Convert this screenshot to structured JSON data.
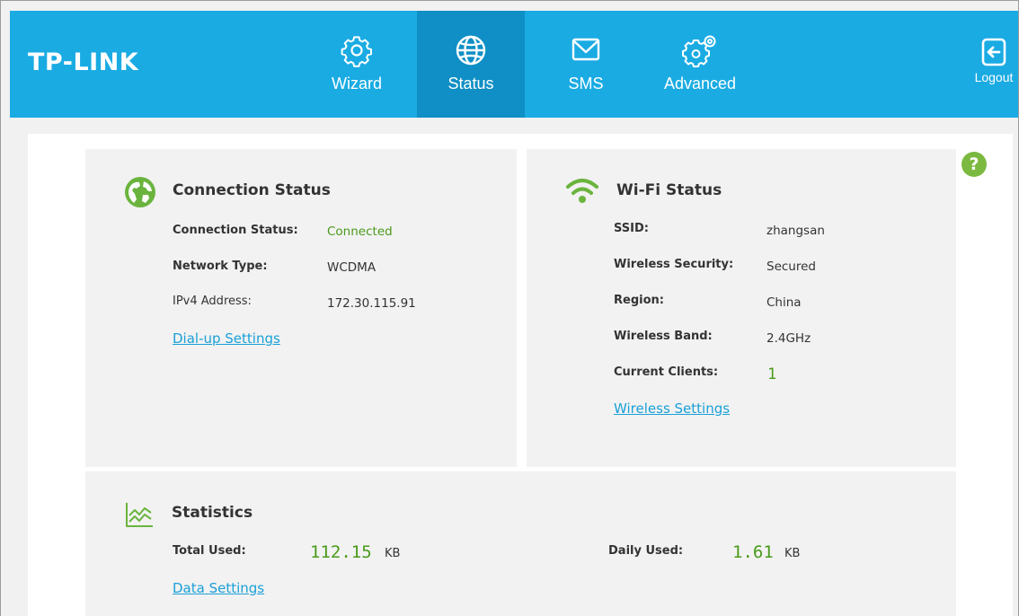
{
  "header": {
    "logo": "TP-LINK",
    "brand_color": "#1aabe3",
    "nav": [
      {
        "label": "Wizard",
        "icon": "gear-icon",
        "active": false
      },
      {
        "label": "Status",
        "icon": "globe-icon",
        "active": true
      },
      {
        "label": "SMS",
        "icon": "envelope-icon",
        "active": false
      },
      {
        "label": "Advanced",
        "icon": "gears-icon",
        "active": false
      }
    ],
    "logout_label": "Logout"
  },
  "connection": {
    "title": "Connection Status",
    "status_label": "Connection Status:",
    "status_value": "Connected",
    "network_type_label": "Network Type:",
    "network_type_value": "WCDMA",
    "ipv4_label": "IPv4 Address:",
    "ipv4_value": "172.30.115.91",
    "link": "Dial-up Settings"
  },
  "wifi": {
    "title": "Wi-Fi Status",
    "ssid_label": "SSID:",
    "ssid_value": "zhangsan",
    "security_label": "Wireless Security:",
    "security_value": "Secured",
    "region_label": "Region:",
    "region_value": "China",
    "band_label": "Wireless Band:",
    "band_value": "2.4GHz",
    "clients_label": "Current Clients:",
    "clients_value": "1",
    "link": "Wireless Settings"
  },
  "statistics": {
    "title": "Statistics",
    "total_label": "Total Used:",
    "total_value": "112.15",
    "total_unit": "KB",
    "daily_label": "Daily Used:",
    "daily_value": "1.61",
    "daily_unit": "KB",
    "link": "Data Settings"
  },
  "help_label": "?",
  "accent_green": "#4a9a1a"
}
